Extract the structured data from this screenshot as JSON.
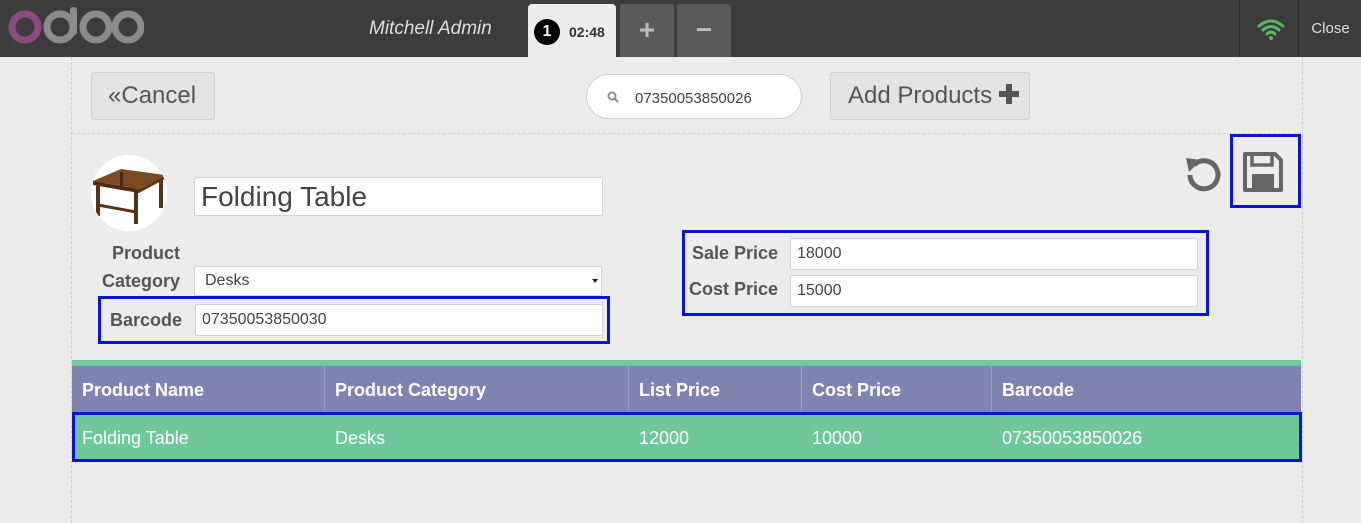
{
  "header": {
    "logo_text": "odoo",
    "user_name": "Mitchell Admin",
    "order_number": "1",
    "order_time": "02:48",
    "add_order_label": "+",
    "remove_order_label": "−",
    "close_label": "Close",
    "wifi_status_color": "#5cb85c"
  },
  "toolbar": {
    "cancel_label": "Cancel",
    "search_value": "07350053850026",
    "add_products_label": "Add Products"
  },
  "product_form": {
    "name": "Folding Table",
    "category_label_line1": "Product",
    "category_label_line2": "Category",
    "category_value": "Desks",
    "barcode_label": "Barcode",
    "barcode_value": "07350053850030",
    "sale_price_label": "Sale Price",
    "sale_price_value": "18000",
    "cost_price_label": "Cost Price",
    "cost_price_value": "15000"
  },
  "table": {
    "headers": [
      "Product Name",
      "Product Category",
      "List Price",
      "Cost Price",
      "Barcode"
    ],
    "rows": [
      [
        "Folding Table",
        "Desks",
        "12000",
        "10000",
        "07350053850026"
      ]
    ]
  },
  "colors": {
    "topbar": "#3c3c3c",
    "table_header": "#7f83b0",
    "table_row": "#6ec89b",
    "highlight_border": "#0a14d8",
    "logo_o": "#8f4a7e"
  }
}
